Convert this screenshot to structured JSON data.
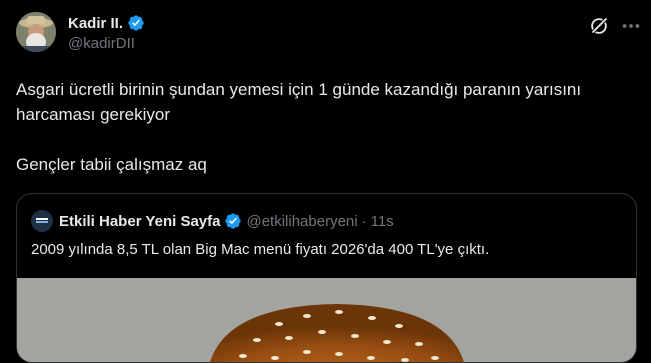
{
  "tweet": {
    "author_name": "Kadir II.",
    "author_handle": "@kadirDII",
    "text": "Asgari ücretli birinin şundan yemesi için 1 günde kazandığı paranın yarısını\nharcaması gerekiyor\n\nGençler tabii çalışmaz aq"
  },
  "quote": {
    "author_name": "Etkili Haber Yeni Sayfa",
    "author_handle": "@etkilihaberyeni",
    "separator": "·",
    "time": "11s",
    "text": "2009 yılında 8,5 TL olan Big Mac menü fiyatı 2026'da 400 TL'ye çıktı."
  },
  "colors": {
    "background": "#000000",
    "text": "#e7e9ea",
    "secondary": "#71767b",
    "verified": "#1d9bf0",
    "border": "#2f3336"
  },
  "icons": [
    "verified-badge-icon",
    "grok-icon",
    "more-icon",
    "burger-photo"
  ]
}
